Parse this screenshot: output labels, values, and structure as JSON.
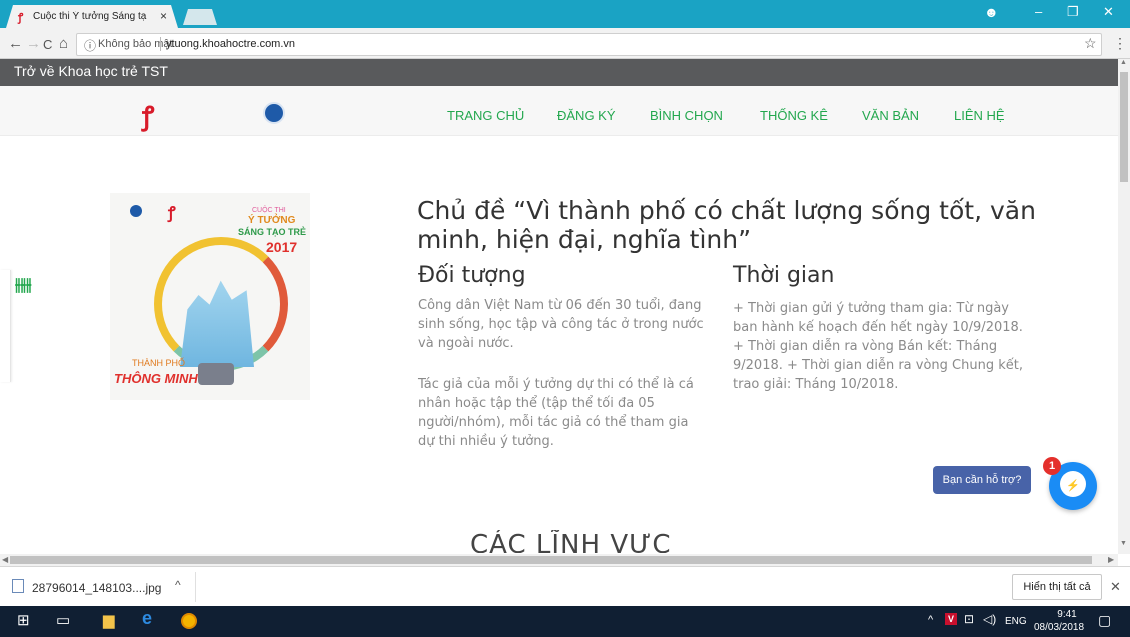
{
  "browser": {
    "tab_title": "Cuộc thi Ý tưởng Sáng tạ",
    "tab_close": "×",
    "favicon": "ꝭ",
    "profile_icon": "☻",
    "minimize": "–",
    "restore": "❐",
    "close": "✕",
    "back": "←",
    "forward": "→",
    "reload": "C",
    "home": "⌂",
    "security_icon": "ⓘ",
    "security_label": "Không bảo mật",
    "url": "ytuong.khoahoctre.com.vn",
    "star": "☆",
    "menu": "⋮"
  },
  "page": {
    "back_link": "Trở về Khoa học trẻ TST",
    "logo_tst": "ꝭ",
    "nav": [
      {
        "label": "TRANG CHỦ"
      },
      {
        "label": "ĐĂNG KÝ"
      },
      {
        "label": "BÌNH CHỌN"
      },
      {
        "label": "THỐNG KÊ"
      },
      {
        "label": "VĂN BẢN"
      },
      {
        "label": "LIÊN HỆ"
      }
    ],
    "poster": {
      "contest": "CUỘC THI",
      "idea": "Ý TƯỞNG",
      "creative": "SÁNG TẠO TRẺ",
      "year": "2017",
      "city": "THÀNH PHỐ",
      "smart": "THÔNG MINH"
    },
    "heading": "Chủ đề “Vì thành phố có chất lượng sống tốt, văn minh, hiện đại, nghĩa tình”",
    "audience_title": "Đối tượng",
    "audience_p1": "Công dân Việt Nam từ 06 đến 30 tuổi, đang sinh sống, học tập và công tác ở trong nước và ngoài nước.",
    "audience_p2": "Tác giả của mỗi ý tưởng dự thi có thể là cá nhân hoặc tập thể (tập thể tối đa 05 người/nhóm), mỗi tác giả có thể tham gia dự thi nhiều ý tưởng.",
    "time_title": "Thời gian",
    "time_p": "+ Thời gian gửi ý tưởng tham gia: Từ ngày ban hành kế hoạch đến hết ngày 10/9/2018. + Thời gian diễn ra vòng Bán kết: Tháng 9/2018. + Thời gian diễn ra vòng Chung kết, trao giải: Tháng 10/2018.",
    "section_title": "CÁC LĨNH VỰC",
    "sliders_icon": "⫲⫲⫲",
    "help_button": "Bạn cần hỗ trợ?",
    "messenger_badge": "1",
    "messenger_bolt": "⚡"
  },
  "downloads": {
    "file_name": "28796014_148103....jpg",
    "caret": "^",
    "show_all": "Hiển thị tất cả",
    "close": "✕"
  },
  "taskbar": {
    "start": "⊞",
    "task_view": "▭",
    "explorer": "▆",
    "edge": "e",
    "tray_up": "^",
    "tray_v": "V",
    "network": "⊡",
    "volume": "◁)",
    "lang": "ENG",
    "time": "9:41",
    "date": "08/03/2018",
    "notify": "▢"
  }
}
